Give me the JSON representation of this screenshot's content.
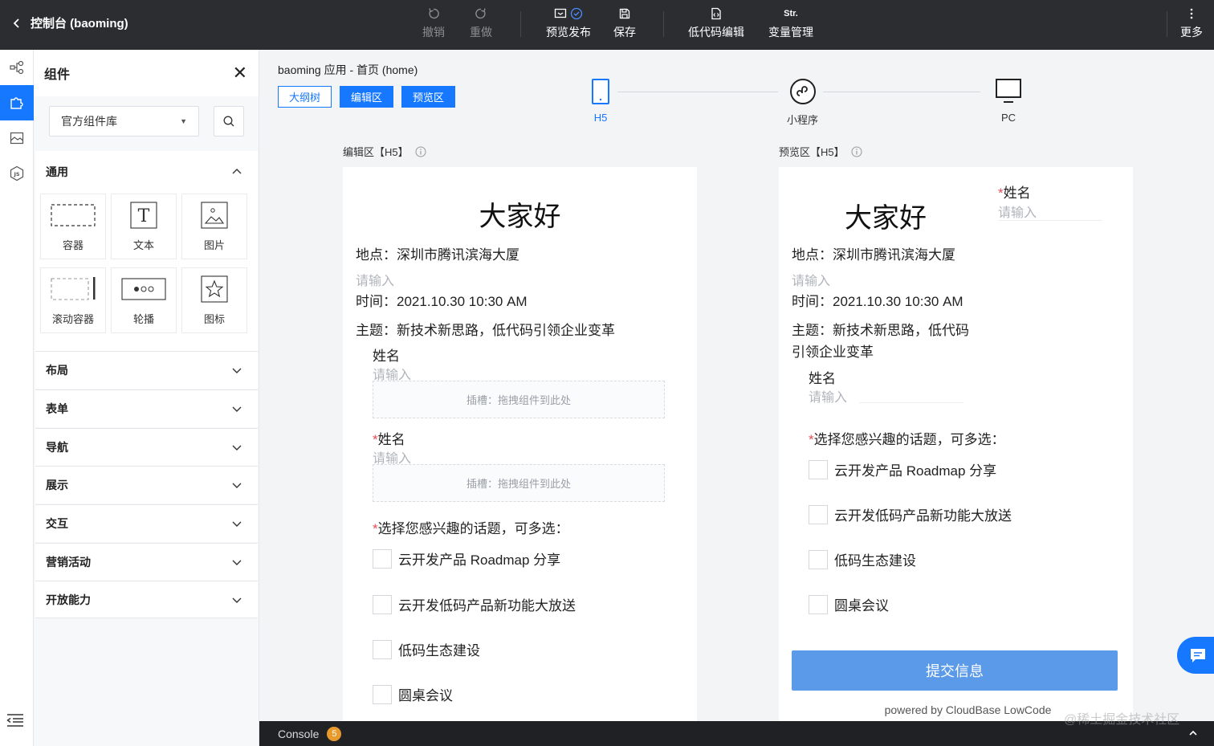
{
  "app": {
    "title": "控制台 (baoming)"
  },
  "toolbar": {
    "undo": "撤销",
    "redo": "重做",
    "preview_publish": "预览发布",
    "save": "保存",
    "lowcode_edit": "低代码编辑",
    "lowcode_icon_text": "Str.",
    "variables": "变量管理",
    "more": "更多"
  },
  "panel": {
    "title": "组件",
    "library": "官方组件库",
    "general": {
      "title": "通用",
      "items": [
        "容器",
        "文本",
        "图片",
        "滚动容器",
        "轮播",
        "图标"
      ]
    },
    "groups": [
      "布局",
      "表单",
      "导航",
      "展示",
      "交互",
      "营销活动",
      "开放能力"
    ]
  },
  "main": {
    "breadcrumb": "baoming 应用 - 首页 (home)",
    "tabs": [
      "大纲树",
      "编辑区",
      "预览区"
    ],
    "devices": [
      "H5",
      "小程序",
      "PC"
    ],
    "edit_label": "编辑区【H5】",
    "preview_label": "预览区【H5】"
  },
  "form": {
    "title": "大家好",
    "location": "地点：深圳市腾讯滨海大厦",
    "placeholder": "请输入",
    "time": "时间：2021.10.30 10:30 AM",
    "topic": "主题：新技术新思路，低代码引领企业变革",
    "topic_line1": "主题：新技术新思路，低代码",
    "topic_line2": "引领企业变革",
    "name_label": "姓名",
    "required_mark": "*",
    "slot_text": "插槽：拖拽组件到此处",
    "question": "选择您感兴趣的话题，可多选：",
    "options": [
      "云开发产品 Roadmap 分享",
      "云开发低码产品新功能大放送",
      "低码生态建设",
      "圆桌会议"
    ],
    "submit": "提交信息",
    "powered_by": "powered by CloudBase LowCode"
  },
  "console": {
    "label": "Console",
    "count": "5"
  },
  "watermark": "@稀土掘金技术社区",
  "colors": {
    "accent": "#1677ff",
    "topbar": "#2b2d31",
    "submit": "#5b9ae8",
    "badge": "#e89b2c"
  }
}
